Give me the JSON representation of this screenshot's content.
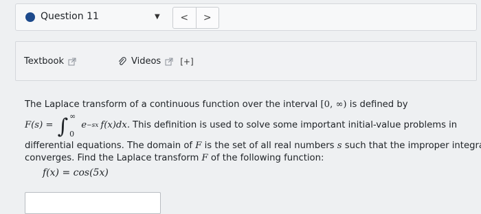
{
  "header": {
    "question_label": "Question 11",
    "prev_glyph": "<",
    "next_glyph": ">"
  },
  "resources": {
    "textbook_label": "Textbook",
    "videos_label": "Videos",
    "videos_extra": "[+]"
  },
  "problem": {
    "intro": "The Laplace transform of a continuous function over the interval",
    "interval": "[0, ∞)",
    "is_defined_by": "is defined by",
    "F_of_s": "F(s) =",
    "upper_limit": "∞",
    "lower_limit": "0",
    "e": "e",
    "exponent": "−sx",
    "integrand": "f(x)dx.",
    "after_integral": "This definition is used to solve some important initial-value problems in",
    "line3_a": "differential equations. The domain of",
    "line3_F": "F",
    "line3_b": "is the set of all real numbers",
    "line3_s": "s",
    "line3_c": "such that the improper integral",
    "line4_a": "converges. Find the Laplace transform",
    "line4_F": "F",
    "line4_b": "of the following function:",
    "function": "f(x) = cos(5x)"
  },
  "icons": [
    "external-link-icon",
    "paperclip-icon",
    "chevron-down-icon"
  ]
}
